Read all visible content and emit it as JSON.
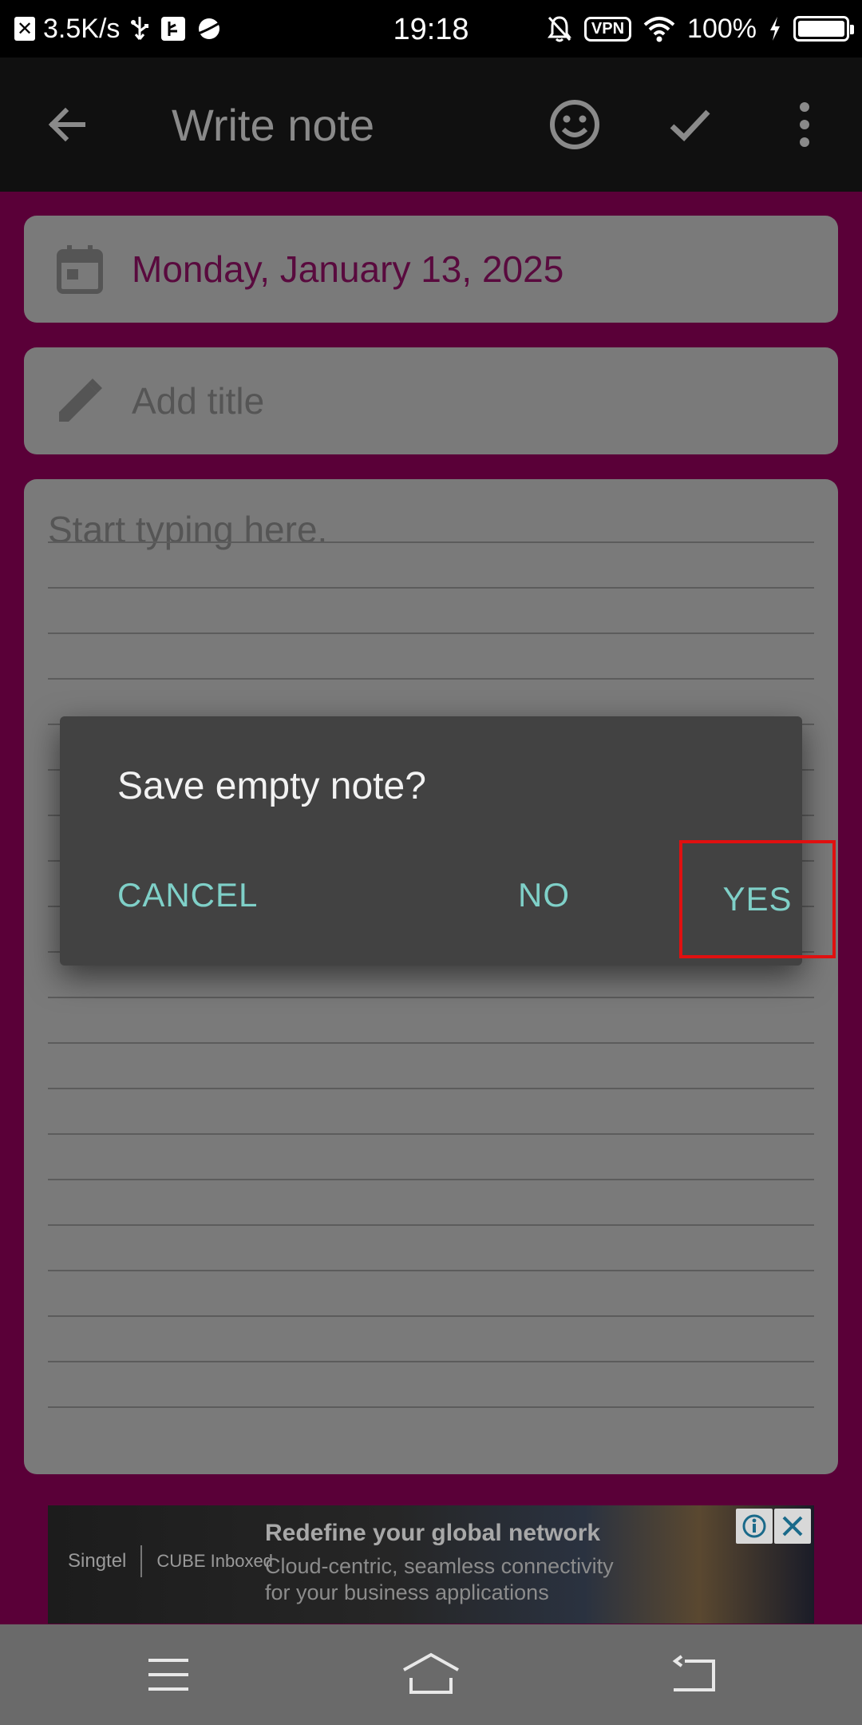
{
  "status_bar": {
    "speed": "3.5K/s",
    "time": "19:18",
    "vpn": "VPN",
    "battery": "100%"
  },
  "toolbar": {
    "title": "Write note",
    "back_icon": "arrow-left-icon",
    "emoji_icon": "smiley-icon",
    "confirm_icon": "check-icon",
    "more_icon": "more-vert-icon"
  },
  "date_card": {
    "date": "Monday, January 13, 2025",
    "icon": "calendar-icon"
  },
  "title_card": {
    "placeholder": "Add title",
    "icon": "pencil-icon"
  },
  "body_card": {
    "placeholder": "Start typing here."
  },
  "dialog": {
    "title": "Save empty note?",
    "cancel": "CANCEL",
    "no": "NO",
    "yes": "YES"
  },
  "ad": {
    "brand_1": "Singtel",
    "brand_2": "CUBE Inboxed",
    "headline": "Redefine your global network",
    "subline_1": "Cloud-centric, seamless connectivity",
    "subline_2": "for your business applications",
    "info_icon": "info-icon",
    "close_icon": "close-icon"
  },
  "nav_bar": {
    "menu_icon": "menu-icon",
    "home_icon": "home-icon",
    "back_icon": "back-icon"
  },
  "colors": {
    "accent_background": "#5a0038",
    "dialog_button": "#7fd0c8",
    "date_text": "#590a3e",
    "highlight_box": "#e01010"
  }
}
